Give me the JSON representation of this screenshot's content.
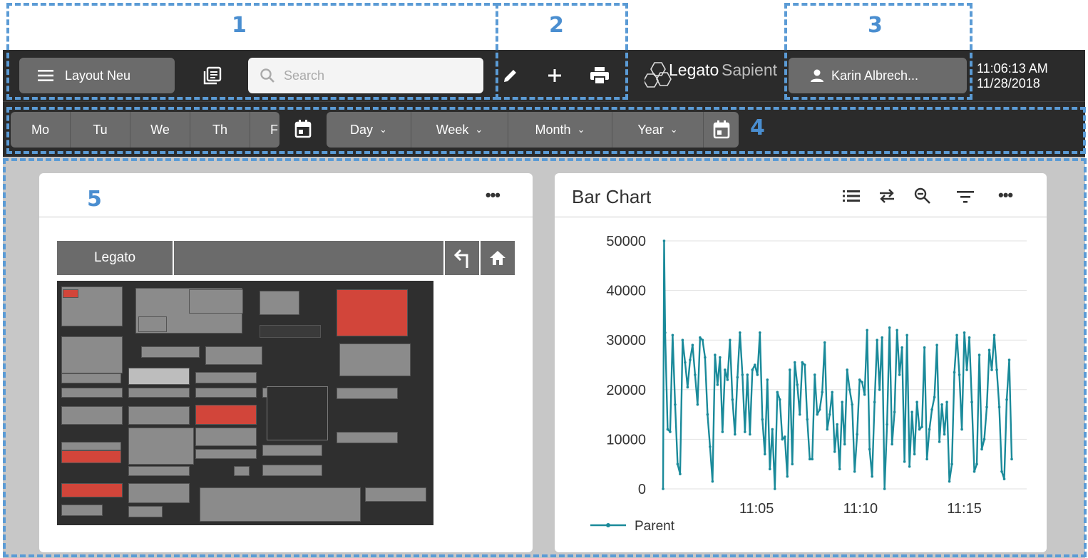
{
  "annotations": [
    "1",
    "2",
    "3",
    "4",
    "5"
  ],
  "toolbar": {
    "layout_label": "Layout Neu",
    "search_placeholder": "Search",
    "logo_text_1": "Legato",
    "logo_text_2": "Sapient",
    "user_label": "Karin Albrech...",
    "time": "11:06:13 AM",
    "date": "11/28/2018"
  },
  "weekdays": [
    "Mo",
    "Tu",
    "We",
    "Th",
    "F"
  ],
  "periods": [
    "Day",
    "Week",
    "Month",
    "Year"
  ],
  "widgets": {
    "treemap": {
      "nav_label": "Legato"
    },
    "bar_chart": {
      "title": "Bar Chart"
    }
  },
  "colors": {
    "bar_bg": "#2b2b2b",
    "button_bg": "#6b6b6b",
    "content_bg": "#c7c7c7",
    "series": "#1a8a9a",
    "annotation": "#5b9bd5",
    "alert": "#d2453a"
  },
  "chart_data": {
    "type": "line",
    "title": "Bar Chart",
    "xlabel": "",
    "ylabel": "",
    "x_tick_labels": [
      "11:05",
      "11:10",
      "11:15"
    ],
    "x_tick_minutes": [
      5,
      10,
      15
    ],
    "xlim_minutes": [
      0.5,
      18.0
    ],
    "ylim": [
      0,
      50000
    ],
    "y_ticks": [
      0,
      10000,
      20000,
      30000,
      40000,
      50000
    ],
    "legend": "bottom-left",
    "series": [
      {
        "name": "Parent",
        "x_minutes": [
          0.5,
          0.55,
          0.6,
          0.72,
          0.84,
          0.96,
          1.08,
          1.2,
          1.32,
          1.44,
          1.56,
          1.68,
          1.8,
          1.92,
          2.04,
          2.16,
          2.28,
          2.4,
          2.52,
          2.64,
          2.76,
          2.88,
          3.0,
          3.12,
          3.24,
          3.36,
          3.48,
          3.6,
          3.72,
          3.84,
          3.96,
          4.08,
          4.2,
          4.32,
          4.44,
          4.56,
          4.68,
          4.8,
          4.92,
          5.04,
          5.16,
          5.28,
          5.4,
          5.52,
          5.64,
          5.76,
          5.88,
          6.0,
          6.12,
          6.24,
          6.36,
          6.48,
          6.6,
          6.72,
          6.84,
          6.96,
          7.08,
          7.2,
          7.32,
          7.44,
          7.56,
          7.68,
          7.8,
          7.92,
          8.04,
          8.16,
          8.28,
          8.4,
          8.52,
          8.64,
          8.76,
          8.88,
          9.0,
          9.12,
          9.24,
          9.36,
          9.48,
          9.6,
          9.72,
          9.84,
          9.96,
          10.08,
          10.2,
          10.32,
          10.44,
          10.56,
          10.68,
          10.8,
          10.92,
          11.04,
          11.16,
          11.28,
          11.4,
          11.52,
          11.64,
          11.76,
          11.88,
          12.0,
          12.12,
          12.24,
          12.36,
          12.48,
          12.6,
          12.72,
          12.84,
          12.96,
          13.08,
          13.2,
          13.32,
          13.44,
          13.56,
          13.68,
          13.8,
          13.92,
          14.04,
          14.16,
          14.28,
          14.4,
          14.52,
          14.64,
          14.76,
          14.88,
          15.0,
          15.12,
          15.24,
          15.36,
          15.48,
          15.6,
          15.72,
          15.84,
          15.96,
          16.08,
          16.2,
          16.32,
          16.44,
          16.56,
          16.68,
          16.8,
          16.92,
          17.04,
          17.16,
          17.28,
          17.4,
          17.52,
          17.64,
          17.76,
          17.88
        ],
        "values": [
          0,
          50000,
          31500,
          12000,
          11500,
          31000,
          17000,
          5000,
          3000,
          30000,
          25500,
          20500,
          26000,
          29000,
          23000,
          17000,
          30500,
          30000,
          26500,
          15000,
          8500,
          1500,
          27000,
          21000,
          26500,
          11500,
          24000,
          22000,
          30000,
          18000,
          11000,
          22500,
          31500,
          23000,
          11500,
          23000,
          11000,
          24000,
          25000,
          23000,
          31500,
          14000,
          7000,
          22000,
          4000,
          12000,
          0,
          19500,
          18000,
          10000,
          10500,
          2500,
          24000,
          5000,
          25500,
          21000,
          15000,
          25500,
          25000,
          14000,
          6000,
          6000,
          23000,
          15000,
          16000,
          19500,
          29500,
          12000,
          15000,
          19500,
          7500,
          13000,
          4000,
          17500,
          9000,
          24000,
          20000,
          17000,
          3500,
          11000,
          22000,
          21500,
          19000,
          32000,
          8000,
          2500,
          17500,
          30000,
          20000,
          30500,
          0,
          13000,
          32500,
          9000,
          15500,
          32000,
          23000,
          28500,
          5500,
          31000,
          4500,
          15500,
          7000,
          17500,
          12000,
          12500,
          28500,
          6000,
          12000,
          16000,
          18500,
          29000,
          9500,
          17000,
          11000,
          17500,
          1500,
          5000,
          23500,
          31000,
          23000,
          12000,
          31500,
          24000,
          30500,
          17500,
          3500,
          5000,
          27000,
          8000,
          10000,
          16500,
          28000,
          24000,
          31000,
          24000,
          16500,
          3500,
          2000,
          18000,
          26000,
          6000
        ],
        "color": "#1a8a9a"
      }
    ]
  }
}
